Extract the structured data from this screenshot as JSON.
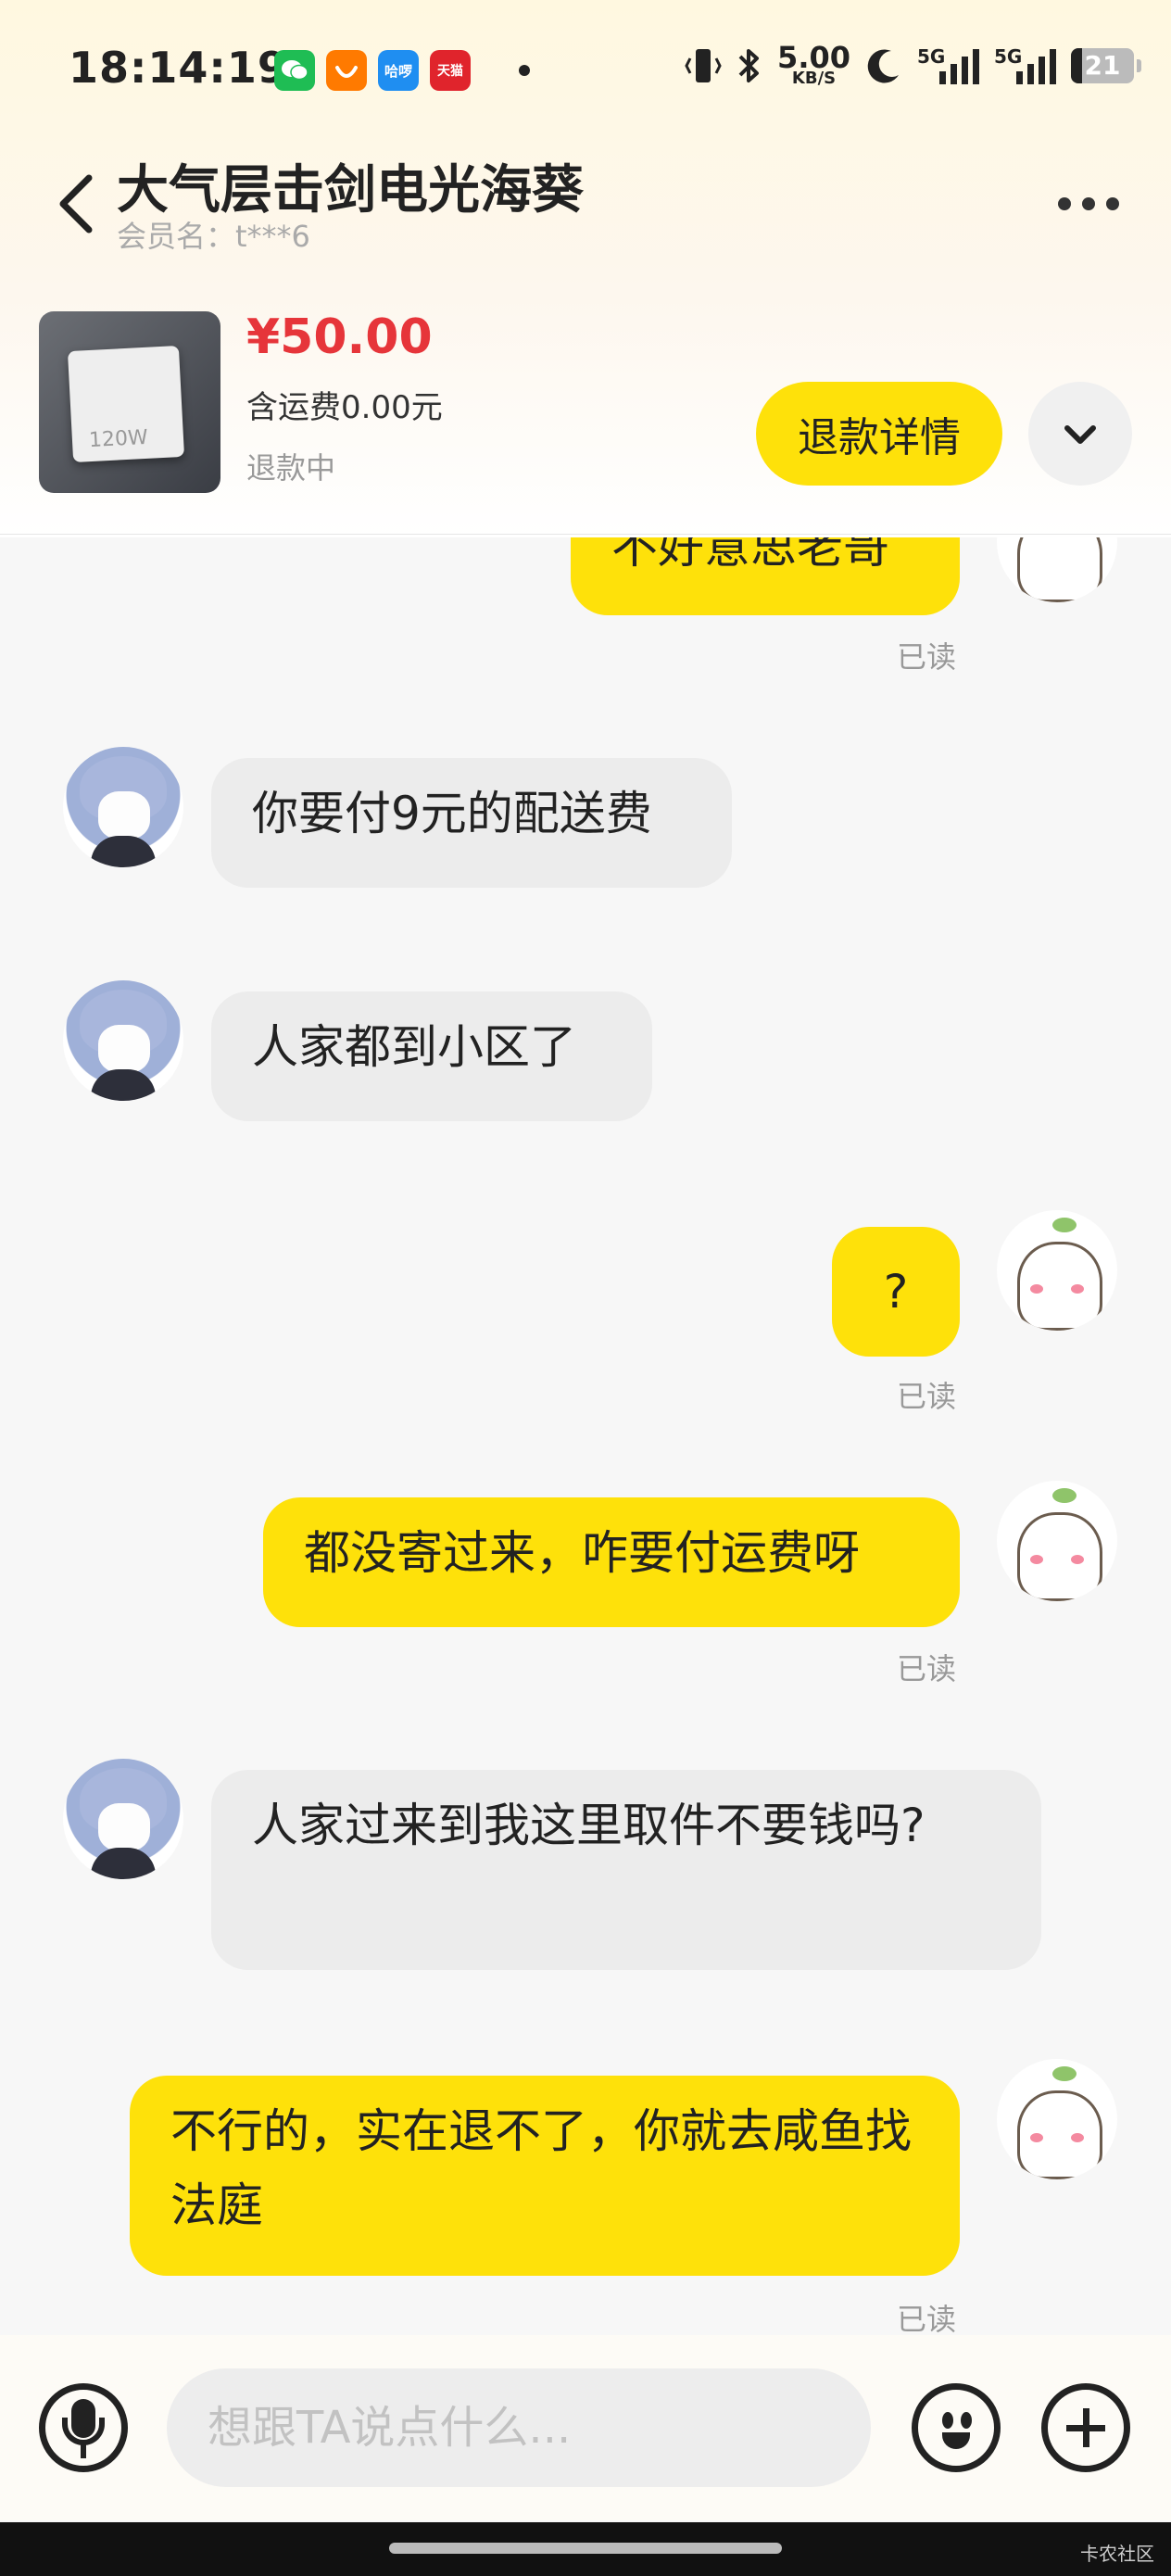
{
  "status_bar": {
    "time": "18:14:19",
    "net_speed": "5.00",
    "net_unit": "KB/S",
    "sig1_label": "5G",
    "sig2_label": "5G",
    "battery": "21",
    "apps": [
      {
        "name": "wechat-icon",
        "color": "#1fbd54"
      },
      {
        "name": "didi-icon",
        "color": "#ff7a00"
      },
      {
        "name": "hellobike-icon",
        "color": "#1f8ef1",
        "text": "哈啰"
      },
      {
        "name": "tmall-icon",
        "color": "#e0242c",
        "text": "天猫"
      }
    ]
  },
  "header": {
    "title": "大气层击剑电光海葵",
    "member": "会员名：t***6"
  },
  "product": {
    "image_label": "120W",
    "price": "¥50.00",
    "shipping": "含运费0.00元",
    "status": "退款中",
    "refund_button": "退款详情"
  },
  "messages": [
    {
      "side": "right",
      "text": "不好意思老哥",
      "read": "已读"
    },
    {
      "side": "left",
      "text": "你要付9元的配送费"
    },
    {
      "side": "left",
      "text": "人家都到小区了"
    },
    {
      "side": "right",
      "text": "?",
      "read": "已读"
    },
    {
      "side": "right",
      "text": "都没寄过来，咋要付运费呀",
      "read": "已读"
    },
    {
      "side": "left",
      "text": "人家过来到我这里取件不要钱吗?"
    },
    {
      "side": "right",
      "text": "不行的，实在退不了，你就去咸鱼找法庭",
      "read": "已读"
    }
  ],
  "input": {
    "placeholder": "想跟TA说点什么..."
  },
  "watermark": "卡农社区",
  "colors": {
    "accent_yellow": "#fee10a",
    "price_red": "#e6353a"
  }
}
